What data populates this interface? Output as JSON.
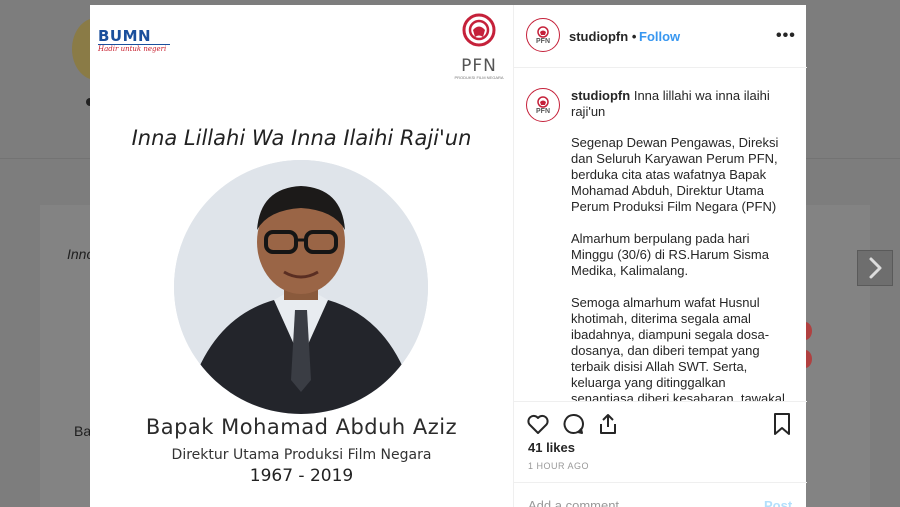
{
  "background": {
    "left_text_top": "Inno",
    "left_text_bottom": "Ba"
  },
  "post_image": {
    "bumn_brand": "BUMN",
    "bumn_tagline": "Hadir untuk negeri",
    "pfn_brand": "PFN",
    "pfn_subtitle": "PRODUKSI FILM NEGARA",
    "headline": "Inna Lillahi Wa Inna Ilaihi Raji'un",
    "person_name": "Bapak Mohamad Abduh Aziz",
    "person_title": "Direktur Utama Produksi Film Negara",
    "years": "1967 - 2019"
  },
  "header": {
    "username": "studiopfn",
    "separator": "•",
    "follow_label": "Follow",
    "more_label": "•••",
    "avatar_text": "PFN"
  },
  "caption": {
    "username": "studiopfn",
    "first_line": "Inna lillahi wa inna ilaihi raji'un",
    "paragraphs": [
      "Segenap Dewan Pengawas, Direksi dan Seluruh Karyawan Perum PFN, berduka cita atas wafatnya Bapak Mohamad Abduh, Direktur Utama Perum Produksi Film Negara (PFN)",
      "Almarhum berpulang pada hari Minggu (30/6) di RS.Harum Sisma Medika, Kalimalang.",
      "Semoga almarhum wafat Husnul khotimah, diterima segala amal ibadahnya, diampuni segala dosa-dosanya, dan diberi tempat yang terbaik disisi Allah SWT. Serta, keluarga yang ditinggalkan senantiasa diberi kesabaran, tawakal"
    ]
  },
  "actions": {
    "likes": "41 likes",
    "time_ago": "1 HOUR AGO"
  },
  "comment": {
    "placeholder": "Add a comment...",
    "post_label": "Post"
  },
  "colors": {
    "link_blue": "#3897f0",
    "brand_red": "#c5213a",
    "bumn_blue": "#1a4f9c"
  }
}
